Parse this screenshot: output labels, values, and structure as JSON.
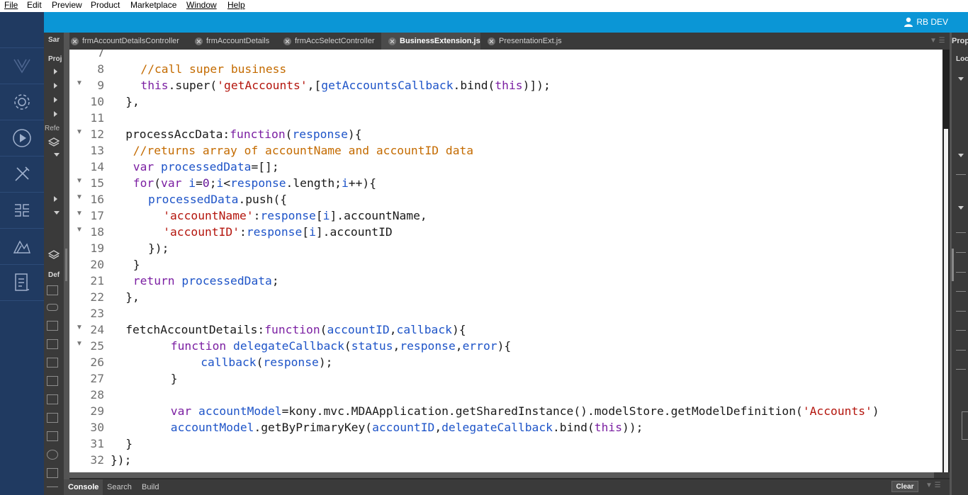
{
  "menu": [
    "File",
    "Edit",
    "Preview",
    "Product",
    "Marketplace",
    "Window",
    "Help"
  ],
  "user": {
    "name": "RB DEV"
  },
  "left_panel": {
    "header_top": "Sar",
    "header_project": "Proj",
    "refs": "Refe",
    "def": "Def"
  },
  "tabs": [
    {
      "label": "frmAccountDetailsController",
      "active": false
    },
    {
      "label": "frmAccountDetails",
      "active": false
    },
    {
      "label": "frmAccSelectController",
      "active": false
    },
    {
      "label": "BusinessExtension.js",
      "active": true
    },
    {
      "label": "PresentationExt.js",
      "active": false
    }
  ],
  "right_panel": {
    "title": "Prop",
    "sub": "Loc"
  },
  "editor": {
    "lines": [
      {
        "n": "7",
        "fold": false,
        "indent": 0,
        "tokens": []
      },
      {
        "n": "8",
        "fold": false,
        "indent": 4,
        "tokens": [
          {
            "t": "//call super business",
            "c": "c"
          }
        ]
      },
      {
        "n": "9",
        "fold": true,
        "indent": 4,
        "tokens": [
          {
            "t": "this",
            "c": "k"
          },
          {
            "t": ".super(",
            "c": "p"
          },
          {
            "t": "'getAccounts'",
            "c": "s"
          },
          {
            "t": ",[",
            "c": "p"
          },
          {
            "t": "getAccountsCallback",
            "c": "v"
          },
          {
            "t": ".bind(",
            "c": "p"
          },
          {
            "t": "this",
            "c": "k"
          },
          {
            "t": ")]);",
            "c": "p"
          }
        ]
      },
      {
        "n": "10",
        "fold": false,
        "indent": 2,
        "tokens": [
          {
            "t": "},",
            "c": "p"
          }
        ]
      },
      {
        "n": "11",
        "fold": false,
        "indent": 0,
        "tokens": []
      },
      {
        "n": "12",
        "fold": true,
        "indent": 2,
        "tokens": [
          {
            "t": "processAccData:",
            "c": "p"
          },
          {
            "t": "function",
            "c": "k"
          },
          {
            "t": "(",
            "c": "p"
          },
          {
            "t": "response",
            "c": "v"
          },
          {
            "t": "){",
            "c": "p"
          }
        ]
      },
      {
        "n": "13",
        "fold": false,
        "indent": 3,
        "tokens": [
          {
            "t": "//returns array of accountName and accountID data",
            "c": "c"
          }
        ]
      },
      {
        "n": "14",
        "fold": false,
        "indent": 3,
        "tokens": [
          {
            "t": "var ",
            "c": "k"
          },
          {
            "t": "processedData",
            "c": "v"
          },
          {
            "t": "=[];",
            "c": "p"
          }
        ]
      },
      {
        "n": "15",
        "fold": true,
        "indent": 3,
        "tokens": [
          {
            "t": "for",
            "c": "k"
          },
          {
            "t": "(",
            "c": "p"
          },
          {
            "t": "var ",
            "c": "k"
          },
          {
            "t": "i",
            "c": "v"
          },
          {
            "t": "=",
            "c": "p"
          },
          {
            "t": "0",
            "c": "n"
          },
          {
            "t": ";",
            "c": "p"
          },
          {
            "t": "i",
            "c": "v"
          },
          {
            "t": "<",
            "c": "p"
          },
          {
            "t": "response",
            "c": "v"
          },
          {
            "t": ".length;",
            "c": "p"
          },
          {
            "t": "i",
            "c": "v"
          },
          {
            "t": "++){",
            "c": "p"
          }
        ]
      },
      {
        "n": "16",
        "fold": true,
        "indent": 5,
        "tokens": [
          {
            "t": "processedData",
            "c": "v"
          },
          {
            "t": ".push({",
            "c": "p"
          }
        ]
      },
      {
        "n": "17",
        "fold": true,
        "indent": 7,
        "tokens": [
          {
            "t": "'accountName'",
            "c": "s"
          },
          {
            "t": ":",
            "c": "p"
          },
          {
            "t": "response",
            "c": "v"
          },
          {
            "t": "[",
            "c": "p"
          },
          {
            "t": "i",
            "c": "v"
          },
          {
            "t": "].accountName,",
            "c": "p"
          }
        ]
      },
      {
        "n": "18",
        "fold": true,
        "indent": 7,
        "tokens": [
          {
            "t": "'accountID'",
            "c": "s"
          },
          {
            "t": ":",
            "c": "p"
          },
          {
            "t": "response",
            "c": "v"
          },
          {
            "t": "[",
            "c": "p"
          },
          {
            "t": "i",
            "c": "v"
          },
          {
            "t": "].accountID",
            "c": "p"
          }
        ]
      },
      {
        "n": "19",
        "fold": false,
        "indent": 5,
        "tokens": [
          {
            "t": "});",
            "c": "p"
          }
        ]
      },
      {
        "n": "20",
        "fold": false,
        "indent": 3,
        "tokens": [
          {
            "t": "}",
            "c": "p"
          }
        ]
      },
      {
        "n": "21",
        "fold": false,
        "indent": 3,
        "tokens": [
          {
            "t": "return ",
            "c": "k"
          },
          {
            "t": "processedData",
            "c": "v"
          },
          {
            "t": ";",
            "c": "p"
          }
        ]
      },
      {
        "n": "22",
        "fold": false,
        "indent": 2,
        "tokens": [
          {
            "t": "},",
            "c": "p"
          }
        ]
      },
      {
        "n": "23",
        "fold": false,
        "indent": 0,
        "tokens": []
      },
      {
        "n": "24",
        "fold": true,
        "indent": 2,
        "tokens": [
          {
            "t": "fetchAccountDetails:",
            "c": "p"
          },
          {
            "t": "function",
            "c": "k"
          },
          {
            "t": "(",
            "c": "p"
          },
          {
            "t": "accountID",
            "c": "v"
          },
          {
            "t": ",",
            "c": "p"
          },
          {
            "t": "callback",
            "c": "v"
          },
          {
            "t": "){",
            "c": "p"
          }
        ]
      },
      {
        "n": "25",
        "fold": true,
        "indent": 8,
        "tokens": [
          {
            "t": "function ",
            "c": "k"
          },
          {
            "t": "delegateCallback",
            "c": "v"
          },
          {
            "t": "(",
            "c": "p"
          },
          {
            "t": "status",
            "c": "v"
          },
          {
            "t": ",",
            "c": "p"
          },
          {
            "t": "response",
            "c": "v"
          },
          {
            "t": ",",
            "c": "p"
          },
          {
            "t": "error",
            "c": "v"
          },
          {
            "t": "){",
            "c": "p"
          }
        ]
      },
      {
        "n": "26",
        "fold": false,
        "indent": 12,
        "tokens": [
          {
            "t": "callback",
            "c": "v"
          },
          {
            "t": "(",
            "c": "p"
          },
          {
            "t": "response",
            "c": "v"
          },
          {
            "t": ");",
            "c": "p"
          }
        ]
      },
      {
        "n": "27",
        "fold": false,
        "indent": 8,
        "tokens": [
          {
            "t": "}",
            "c": "p"
          }
        ]
      },
      {
        "n": "28",
        "fold": false,
        "indent": 0,
        "tokens": []
      },
      {
        "n": "29",
        "fold": false,
        "indent": 8,
        "tokens": [
          {
            "t": "var ",
            "c": "k"
          },
          {
            "t": "accountModel",
            "c": "v"
          },
          {
            "t": "=kony.mvc.MDAApplication.getSharedInstance().modelStore.getModelDefinition(",
            "c": "p"
          },
          {
            "t": "'Accounts'",
            "c": "s"
          },
          {
            "t": ")",
            "c": "p"
          }
        ]
      },
      {
        "n": "30",
        "fold": false,
        "indent": 8,
        "tokens": [
          {
            "t": "accountModel",
            "c": "v"
          },
          {
            "t": ".getByPrimaryKey(",
            "c": "p"
          },
          {
            "t": "accountID",
            "c": "v"
          },
          {
            "t": ",",
            "c": "p"
          },
          {
            "t": "delegateCallback",
            "c": "v"
          },
          {
            "t": ".bind(",
            "c": "p"
          },
          {
            "t": "this",
            "c": "k"
          },
          {
            "t": "));",
            "c": "p"
          }
        ]
      },
      {
        "n": "31",
        "fold": false,
        "indent": 2,
        "tokens": [
          {
            "t": "}",
            "c": "p"
          }
        ]
      },
      {
        "n": "32",
        "fold": false,
        "indent": 0,
        "tokens": [
          {
            "t": "});",
            "c": "p"
          }
        ]
      }
    ]
  },
  "bottom_tabs": [
    {
      "label": "Console",
      "active": true
    },
    {
      "label": "Search",
      "active": false
    },
    {
      "label": "Build",
      "active": false
    }
  ],
  "clear_label": "Clear",
  "colors": {
    "accent": "#0b96d6",
    "rail": "#203a61",
    "keyword": "#7b1fa2",
    "variable": "#1e54c8",
    "string": "#b4150d",
    "comment": "#c46b00"
  }
}
